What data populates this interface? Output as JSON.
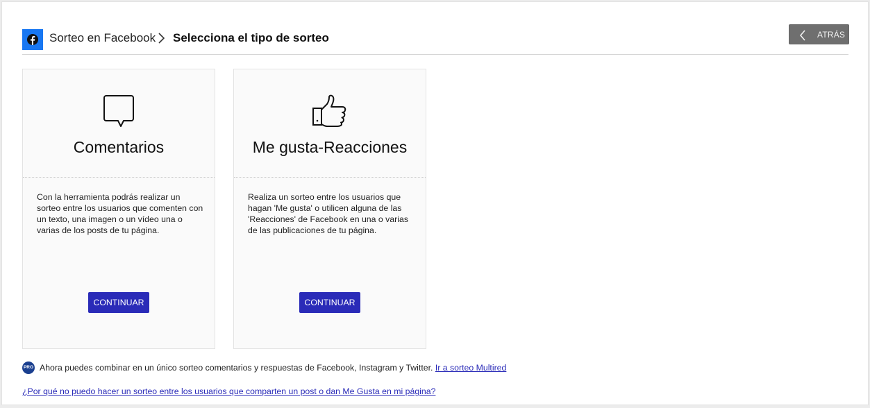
{
  "header": {
    "breadcrumb_link": "Sorteo en Facebook",
    "breadcrumb_current": "Selecciona el tipo de sorteo",
    "back_label": "ATRÁS"
  },
  "cards": [
    {
      "icon": "speech-bubble-icon",
      "title": "Comentarios",
      "description": "Con la herramienta podrás realizar un sorteo entre los usuarios que comenten con un texto, una imagen o un vídeo una o varias de los posts de tu página.",
      "button": "CONTINUAR"
    },
    {
      "icon": "thumbs-up-icon",
      "title": "Me gusta-Reacciones",
      "description": "Realiza un sorteo entre los usuarios que hagan 'Me gusta' o utilicen alguna de las 'Reacciones' de Facebook en una o varias de las publicaciones de tu página.",
      "button": "CONTINUAR"
    }
  ],
  "notice": {
    "badge": "PRO",
    "text": "Ahora puedes combinar en un único sorteo comentarios y respuestas de Facebook, Instagram y Twitter.",
    "link": "Ir a sorteo Multired"
  },
  "help_link": "¿Por qué no puedo hacer un sorteo entre los usuarios que comparten un post o dan Me Gusta en mi página?",
  "colors": {
    "facebook_blue": "#1877f2",
    "button_blue": "#2a2bb8",
    "back_button_gray": "#6f6f6f",
    "pro_badge": "#1a3f8f"
  }
}
